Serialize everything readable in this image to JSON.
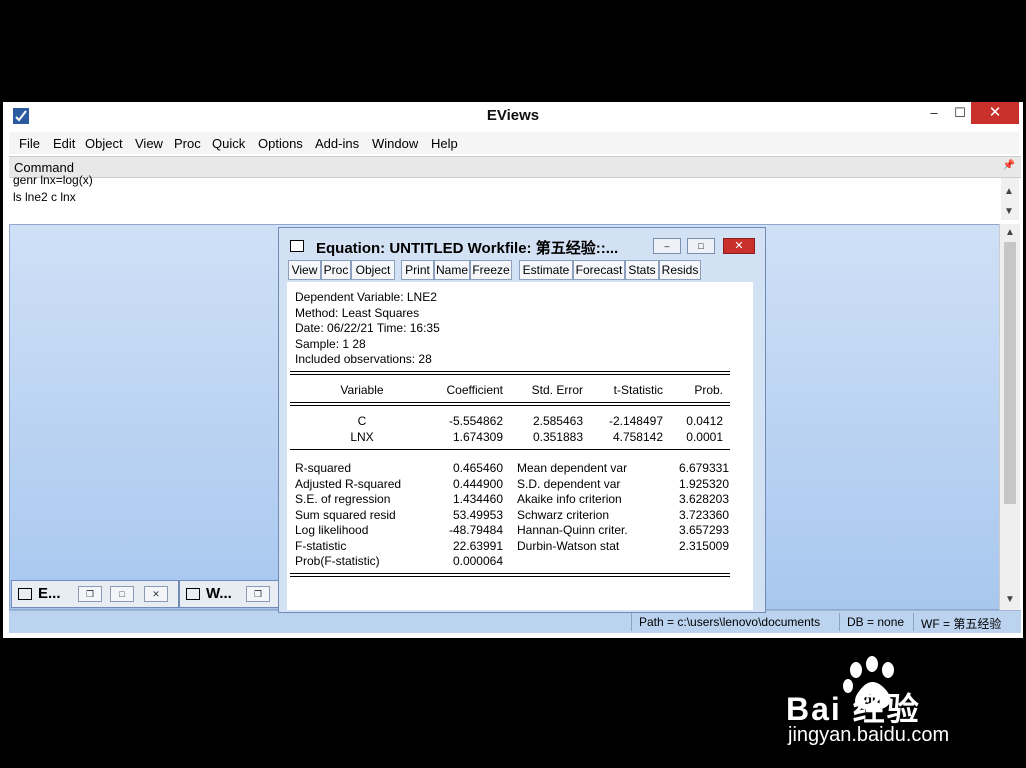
{
  "window": {
    "title": "EViews",
    "controls": {
      "minimize": "–",
      "maximize": "☐",
      "close": "✕"
    }
  },
  "menu": [
    "File",
    "Edit",
    "Object",
    "View",
    "Proc",
    "Quick",
    "Options",
    "Add-ins",
    "Window",
    "Help"
  ],
  "command": {
    "header": "Command",
    "lines": [
      "genr lnx=log(x)",
      "ls lne2 c lnx"
    ]
  },
  "minimized_windows": [
    {
      "title": "E..."
    },
    {
      "title": "W..."
    }
  ],
  "status": {
    "path": "Path = c:\\users\\lenovo\\documents",
    "db": "DB = none",
    "wf": "WF = 第五经验"
  },
  "equation_window": {
    "title": "Equation: UNTITLED   Workfile: 第五经验::...",
    "toolbar": [
      "View",
      "Proc",
      "Object",
      "Print",
      "Name",
      "Freeze",
      "Estimate",
      "Forecast",
      "Stats",
      "Resids"
    ],
    "header_lines": [
      "Dependent Variable: LNE2",
      "Method: Least Squares",
      "Date: 06/22/21   Time: 16:35",
      "Sample: 1 28",
      "Included observations: 28"
    ],
    "columns": [
      "Variable",
      "Coefficient",
      "Std. Error",
      "t-Statistic",
      "Prob."
    ],
    "rows": [
      [
        "C",
        "-5.554862",
        "2.585463",
        "-2.148497",
        "0.0412"
      ],
      [
        "LNX",
        "1.674309",
        "0.351883",
        "4.758142",
        "0.0001"
      ]
    ],
    "stats": [
      [
        "R-squared",
        "0.465460",
        "Mean dependent var",
        "6.679331"
      ],
      [
        "Adjusted R-squared",
        "0.444900",
        "S.D. dependent var",
        "1.925320"
      ],
      [
        "S.E. of regression",
        "1.434460",
        "Akaike info criterion",
        "3.628203"
      ],
      [
        "Sum squared resid",
        "53.49953",
        "Schwarz criterion",
        "3.723360"
      ],
      [
        "Log likelihood",
        "-48.79484",
        "Hannan-Quinn criter.",
        "3.657293"
      ],
      [
        "F-statistic",
        "22.63991",
        "Durbin-Watson stat",
        "2.315009"
      ],
      [
        "Prob(F-statistic)",
        "0.000064",
        "",
        ""
      ]
    ]
  },
  "watermark": {
    "brand": "Bai 经验",
    "url": "jingyan.baidu.com"
  }
}
